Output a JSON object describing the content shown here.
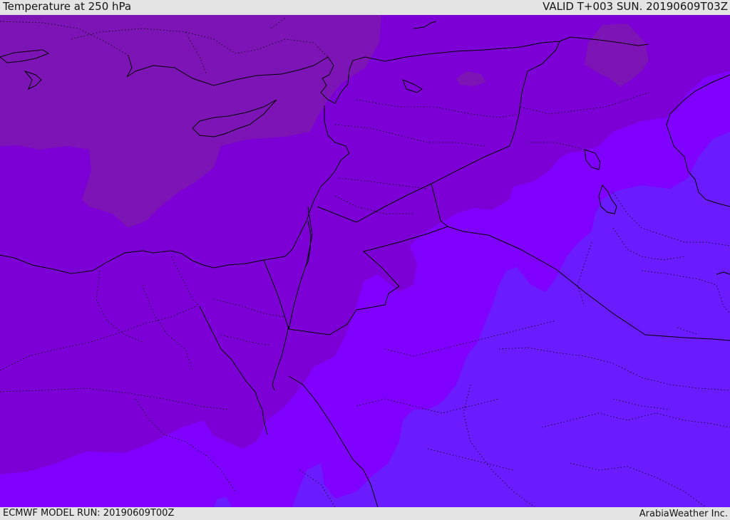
{
  "header": {
    "title": "Temperature at 250 hPa",
    "valid_time": "VALID T+003 SUN. 20190609T03Z"
  },
  "footer": {
    "model_run": "ECMWF MODEL RUN: 20190609T00Z",
    "credit": "ArabiaWeather Inc."
  },
  "map": {
    "field": "temperature-250hpa",
    "colors": {
      "band_warmest": "#7d14b5",
      "band_warm": "#7c00d6",
      "band_mid": "#8000ff",
      "band_cool": "#6b1bff",
      "coast_border": "#000000"
    }
  }
}
